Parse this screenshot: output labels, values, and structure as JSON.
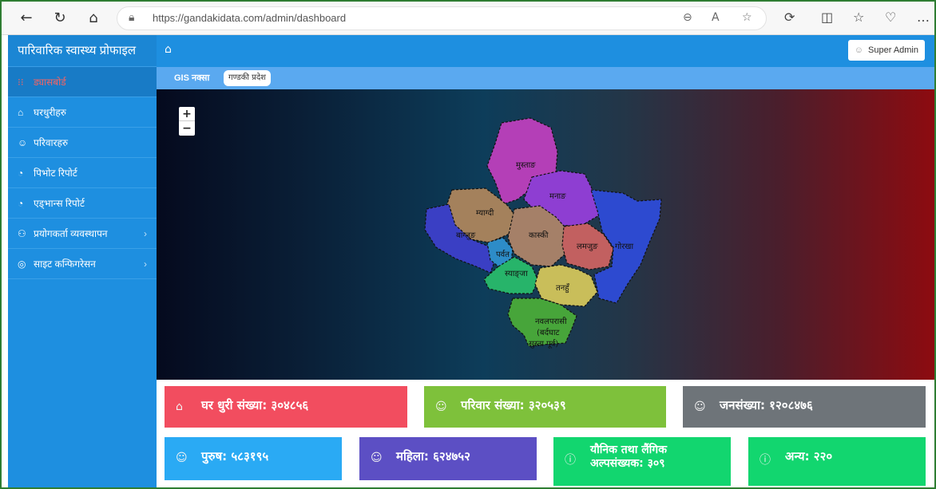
{
  "browser": {
    "url": "https://gandakidata.com/admin/dashboard"
  },
  "sidebar": {
    "brand": "पारिवारिक स्वास्थ्य प्रोफाइल",
    "items": [
      {
        "label": "ड्यासबोर्ड",
        "icon": "grid-icon"
      },
      {
        "label": "घरधुरीहरु",
        "icon": "home-icon"
      },
      {
        "label": "परिवारहरु",
        "icon": "users-icon"
      },
      {
        "label": "पिभोट रिपोर्ट",
        "icon": "pie-icon"
      },
      {
        "label": "एड्भान्स रिपोर्ट",
        "icon": "pie-icon"
      },
      {
        "label": "प्रयोगकर्ता व्यवस्थापन",
        "icon": "user-plus-icon"
      },
      {
        "label": "साइट कन्फिगरेसन",
        "icon": "settings-icon"
      }
    ]
  },
  "header": {
    "admin_label": "Super Admin"
  },
  "subbar": {
    "gis_label": "GIS नक्सा",
    "province": "गण्डकी प्रदेश"
  },
  "map": {
    "districts": [
      "मुस्ताङ",
      "मनाङ",
      "म्याग्दी",
      "बाग्लुङ",
      "पर्वत",
      "कास्की",
      "लमजुङ",
      "गोरखा",
      "स्याङ्जा",
      "तनहुँ",
      "नवलपरासी",
      "(बर्दघाट",
      "सुस्ता पूर्व)"
    ],
    "zoom_in": "+",
    "zoom_out": "−"
  },
  "stats": {
    "households": "घर धुरी संख्या: ३०४८५६",
    "families": "परिवार संख्या: ३२०५३९",
    "population": "जनसंख्या: १२०८४७६",
    "male": "पुरुष: ५८३१९५",
    "female": "महिला: ६२४७५२",
    "lgbt_line1": "यौनिक तथा लैंगिक",
    "lgbt_line2": "अल्पसंख्यक: ३०९",
    "other": "अन्य: २२०"
  },
  "colors": {
    "sidebar": "#1e8fe0",
    "households": "#f24d5f",
    "families": "#7ec13b",
    "population": "#6e7479",
    "male": "#2aaaf4",
    "female": "#5c4fc4",
    "lgbt": "#12d66f",
    "other": "#12d66f"
  }
}
